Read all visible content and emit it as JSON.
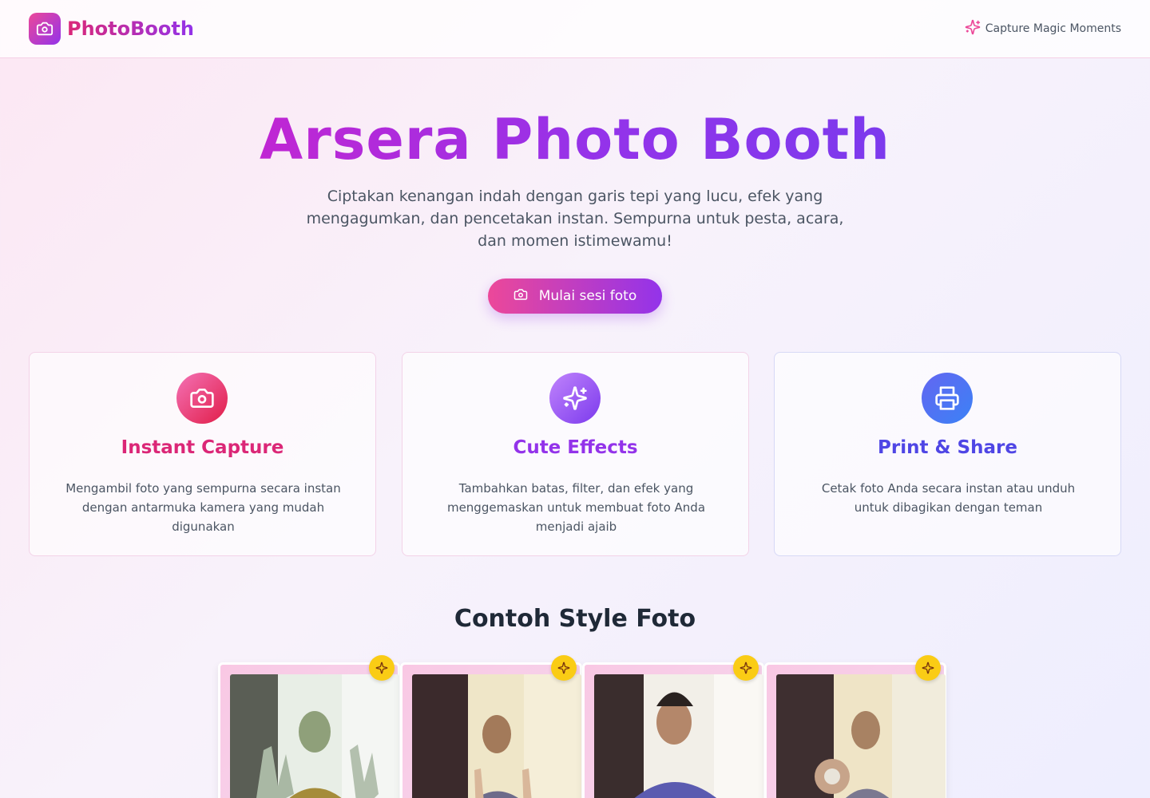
{
  "header": {
    "brand": "PhotoBooth",
    "tagline": "Capture Magic Moments"
  },
  "hero": {
    "title": "Arsera Photo Booth",
    "subtitle": "Ciptakan kenangan indah dengan garis tepi yang lucu, efek yang mengagumkan, dan pencetakan instan. Sempurna untuk pesta, acara, dan momen istimewamu!",
    "cta_label": "Mulai sesi foto"
  },
  "features": [
    {
      "title": "Instant Capture",
      "description": "Mengambil foto yang sempurna secara instan dengan antarmuka kamera yang mudah digunakan",
      "icon": "camera-icon",
      "color": "#db2777"
    },
    {
      "title": "Cute Effects",
      "description": "Tambahkan batas, filter, dan efek yang menggemaskan untuk membuat foto Anda menjadi ajaib",
      "icon": "sparkles-icon",
      "color": "#9333ea"
    },
    {
      "title": "Print & Share",
      "description": "Cetak foto Anda secara instan atau unduh untuk dibagikan dengan teman",
      "icon": "printer-icon",
      "color": "#4f46e5"
    }
  ],
  "samples": {
    "title": "Contoh Style Foto",
    "items": [
      {
        "badge_icon": "sparkles-icon"
      },
      {
        "badge_icon": "sparkles-icon"
      },
      {
        "badge_icon": "sparkles-icon"
      },
      {
        "badge_icon": "sparkles-icon"
      }
    ]
  }
}
